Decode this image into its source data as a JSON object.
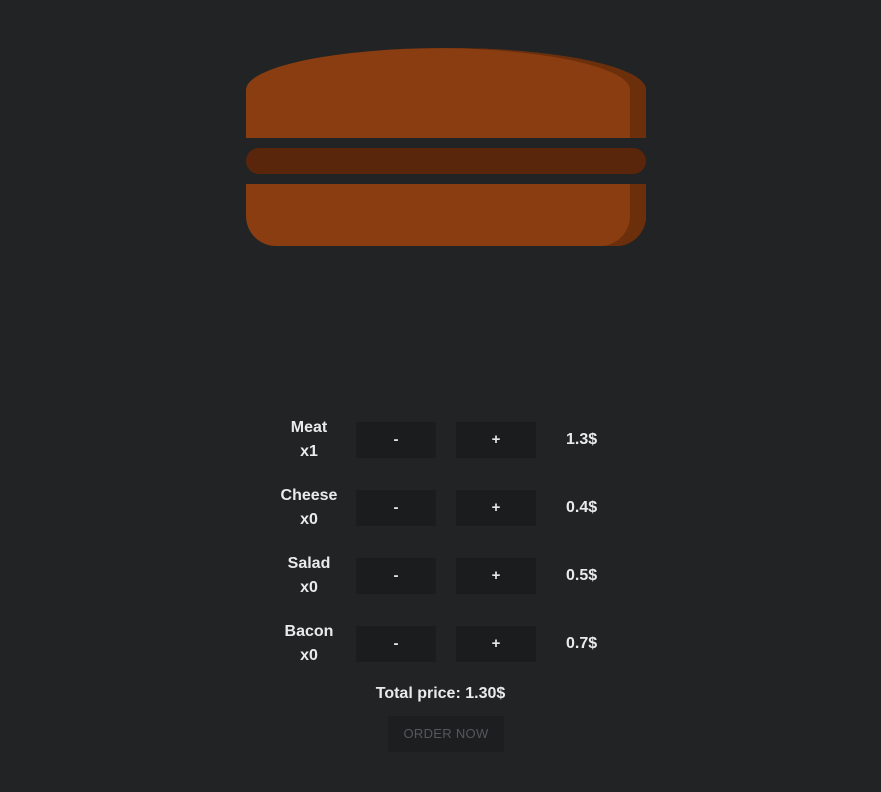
{
  "ingredients": [
    {
      "name": "Meat",
      "count": "x1",
      "minus": "-",
      "plus": "+",
      "price": "1.3$"
    },
    {
      "name": "Cheese",
      "count": "x0",
      "minus": "-",
      "plus": "+",
      "price": "0.4$"
    },
    {
      "name": "Salad",
      "count": "x0",
      "minus": "-",
      "plus": "+",
      "price": "0.5$"
    },
    {
      "name": "Bacon",
      "count": "x0",
      "minus": "-",
      "plus": "+",
      "price": "0.7$"
    }
  ],
  "total": {
    "text": "Total price: 1.30$"
  },
  "order": {
    "label": "ORDER NOW",
    "disabled": true
  },
  "colors": {
    "background": "#222325",
    "bun": "#8a3d10",
    "bun_shade": "#6b2f0c",
    "patty": "#5a260b",
    "button_bg": "#1b1c1e"
  }
}
